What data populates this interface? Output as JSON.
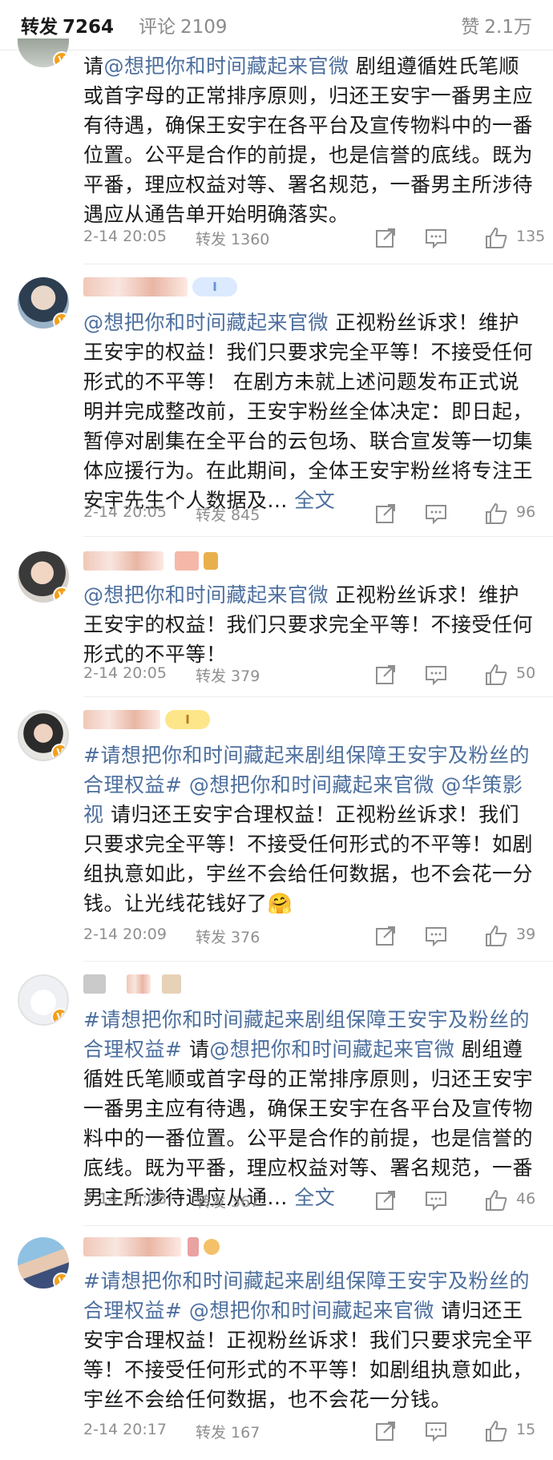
{
  "tabs": {
    "repost_label": "转发",
    "repost_count": "7264",
    "comment_label": "评论",
    "comment_count": "2109",
    "like_label": "赞",
    "like_count": "2.1万"
  },
  "comments": [
    {
      "segments": [
        {
          "t": "请"
        },
        {
          "t": "@想把你和时间藏起来官微",
          "link": true
        },
        {
          "t": " 剧组遵循姓氏笔顺或首字母的正常排序原则，归还王安宇一番男主应有待遇，确保王安宇在各平台及宣传物料中的一番位置。公平是合作的前提，也是信誉的底线。既为平番，理应权益对等、署名规范，一番男主所涉待遇应从通告单开始明确落实。"
        }
      ],
      "time": "2-14 20:05",
      "repost": "转发 1360",
      "likes": "135"
    },
    {
      "level": "I",
      "segments": [
        {
          "t": "@想把你和时间藏起来官微",
          "link": true
        },
        {
          "t": " 正视粉丝诉求！维护王安宇的权益！我们只要求完全平等！不接受任何形式的不平等！ 在剧方未就上述问题发布正式说明并完成整改前，王安宇粉丝全体决定：即日起，暂停对剧集在全平台的云包场、联合宣发等一切集体应援行为。在此期间，全体王安宇粉丝将专注王安宇先生个人数据及... "
        },
        {
          "t": "全文",
          "link": true
        }
      ],
      "time": "2-14 20:05",
      "repost": "转发 845",
      "likes": "96"
    },
    {
      "segments": [
        {
          "t": "@想把你和时间藏起来官微",
          "link": true
        },
        {
          "t": "  正视粉丝诉求！维护王安宇的权益！我们只要求完全平等！不接受任何形式的不平等！"
        }
      ],
      "time": "2-14 20:05",
      "repost": "转发 379",
      "likes": "50"
    },
    {
      "level": "I",
      "segments": [
        {
          "t": "#请想把你和时间藏起来剧组保障王安宇及粉丝的合理权益#",
          "link": true
        },
        {
          "t": " "
        },
        {
          "t": "@想把你和时间藏起来官微",
          "link": true
        },
        {
          "t": " "
        },
        {
          "t": "@华策影视",
          "link": true
        },
        {
          "t": " 请归还王安宇合理权益！正视粉丝诉求！我们只要求完全平等！不接受任何形式的不平等！如剧组执意如此，宇丝不会给任何数据，也不会花一分钱。让光线花钱好了🤗"
        }
      ],
      "time": "2-14 20:09",
      "repost": "转发 376",
      "likes": "39"
    },
    {
      "segments": [
        {
          "t": "#请想把你和时间藏起来剧组保障王安宇及粉丝的合理权益#",
          "link": true
        },
        {
          "t": " 请"
        },
        {
          "t": "@想把你和时间藏起来官微",
          "link": true
        },
        {
          "t": " 剧组遵循姓氏笔顺或首字母的正常排序原则，归还王安宇一番男主应有待遇，确保王安宇在各平台及宣传物料中的一番位置。公平是合作的前提，也是信誉的底线。既为平番，理应权益对等、署名规范，一番男主所涉待遇应从通... "
        },
        {
          "t": "全文",
          "link": true
        }
      ],
      "time": "2-14 20:08",
      "repost": "转发 367",
      "likes": "46"
    },
    {
      "segments": [
        {
          "t": "#请想把你和时间藏起来剧组保障王安宇及粉丝的合理权益#",
          "link": true
        },
        {
          "t": " "
        },
        {
          "t": "@想把你和时间藏起来官微",
          "link": true
        },
        {
          "t": " 请归还王安宇合理权益！正视粉丝诉求！我们只要求完全平等！不接受任何形式的不平等！如剧组执意如此，宇丝不会给任何数据，也不会花一分钱。"
        }
      ],
      "time": "2-14 20:17",
      "repost": "转发 167",
      "likes": "15"
    }
  ]
}
